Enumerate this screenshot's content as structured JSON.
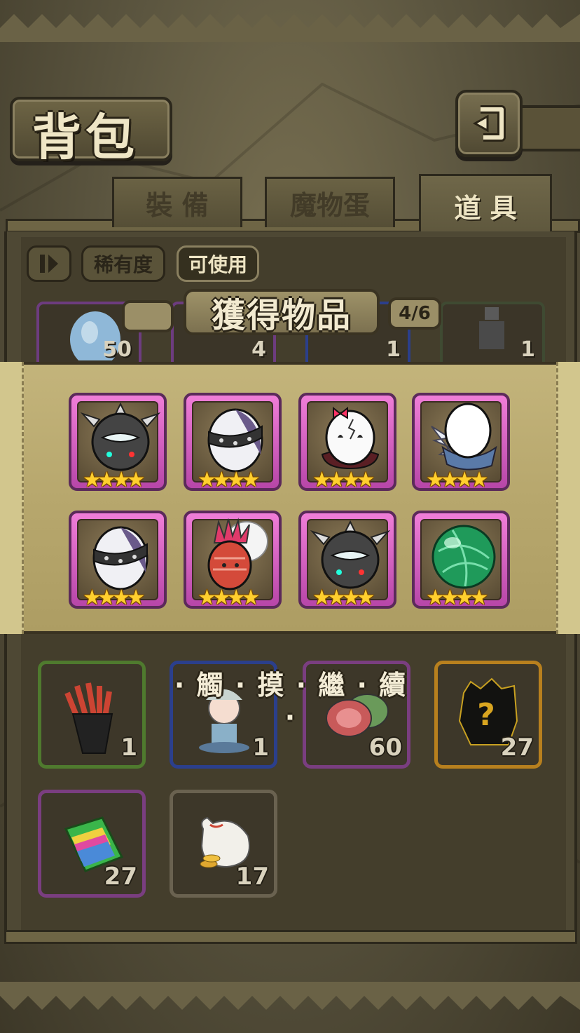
{
  "title": "背包",
  "tabs": [
    {
      "label": "裝 備",
      "active": false
    },
    {
      "label": "魔物蛋",
      "active": false
    },
    {
      "label": "道 具",
      "active": true
    }
  ],
  "filters": {
    "sort_icon": "sort-icon",
    "rarity_label": "稀有度",
    "usable_label": "可使用"
  },
  "reward": {
    "header": "獲得物品",
    "page_count": "4/6",
    "items": [
      {
        "name": "spiked-black-egg",
        "stars": 4
      },
      {
        "name": "banded-purple-egg",
        "stars": 4
      },
      {
        "name": "cracked-bow-egg",
        "stars": 4
      },
      {
        "name": "winged-white-egg",
        "stars": 4
      },
      {
        "name": "banded-purple-egg",
        "stars": 4
      },
      {
        "name": "feathered-red-egg",
        "stars": 4
      },
      {
        "name": "spiked-black-egg",
        "stars": 4
      },
      {
        "name": "green-orb-egg",
        "stars": 4
      }
    ],
    "star_glyph": "★★★★"
  },
  "partial_row_counts": [
    "50",
    "4",
    "1",
    "1"
  ],
  "tap_continue": "· 觸 · 摸 · 繼 · 續 ·",
  "inventory": [
    {
      "name": "bottle-bag",
      "count": "1",
      "rarity_color": "#4f7a2e"
    },
    {
      "name": "doll-figure",
      "count": "1",
      "rarity_color": "#2b3f8c"
    },
    {
      "name": "meat",
      "count": "60",
      "rarity_color": "#7a3e80"
    },
    {
      "name": "mystery-silhouette",
      "count": "27",
      "rarity_color": "#b8801e"
    },
    {
      "name": "card-deck",
      "count": "27",
      "rarity_color": "#7a3e80"
    },
    {
      "name": "coin-sack",
      "count": "17",
      "rarity_color": "#6a6250"
    }
  ]
}
